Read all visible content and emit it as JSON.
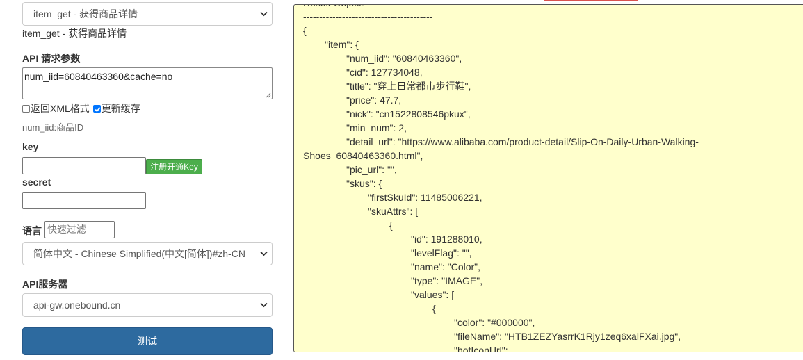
{
  "form": {
    "api_select_value": "item_get - 获得商品详情",
    "api_name_text": "item_get - 获得商品详情",
    "params_label": "API 请求参数",
    "params_value": "num_iid=60840463360&cache=no",
    "xml_checkbox_label": "返回XML格式",
    "xml_checked": false,
    "cache_checkbox_label": "更新缓存",
    "cache_checked": true,
    "param_hint": "num_iid:商品ID",
    "key_label": "key",
    "key_value": "",
    "register_button": "注册开通Key",
    "secret_label": "secret",
    "secret_value": "",
    "lang_label": "语言",
    "lang_filter_placeholder": "快速过滤",
    "lang_select_value": "简体中文 - Chinese Simplified(中文[简体])#zh-CN",
    "server_label": "API服务器",
    "server_select_value": "api-gw.onebound.cn",
    "test_button": "测试"
  },
  "result": {
    "header_partial": "Result Object:",
    "lines": [
      {
        "indent": 0,
        "text": "Result Object:"
      },
      {
        "indent": 0,
        "text": "----------------------------------------"
      },
      {
        "indent": 0,
        "text": "{"
      },
      {
        "indent": 1,
        "text": "\"item\": {"
      },
      {
        "indent": 2,
        "text": "\"num_iid\": \"60840463360\","
      },
      {
        "indent": 2,
        "text": "\"cid\": 127734048,"
      },
      {
        "indent": 2,
        "text": "\"title\": \"穿上日常都市步行鞋\","
      },
      {
        "indent": 2,
        "text": "\"price\": 47.7,"
      },
      {
        "indent": 2,
        "text": "\"nick\": \"cn1522808546pkux\","
      },
      {
        "indent": 2,
        "text": "\"min_num\": 2,"
      },
      {
        "indent": 2,
        "text": "\"detail_url\": \"https://www.alibaba.com/product-detail/Slip-On-Daily-Urban-Walking-"
      },
      {
        "indent": 0,
        "text": "Shoes_60840463360.html\","
      },
      {
        "indent": 2,
        "text": "\"pic_url\": \"\","
      },
      {
        "indent": 2,
        "text": "\"skus\": {"
      },
      {
        "indent": 3,
        "text": "\"firstSkuId\": 11485006221,"
      },
      {
        "indent": 3,
        "text": "\"skuAttrs\": ["
      },
      {
        "indent": 4,
        "text": "{"
      },
      {
        "indent": 5,
        "text": "\"id\": 191288010,"
      },
      {
        "indent": 5,
        "text": "\"levelFlag\": \"\","
      },
      {
        "indent": 5,
        "text": "\"name\": \"Color\","
      },
      {
        "indent": 5,
        "text": "\"type\": \"IMAGE\","
      },
      {
        "indent": 5,
        "text": "\"values\": ["
      },
      {
        "indent": 6,
        "text": "{"
      },
      {
        "indent": 7,
        "text": "\"color\": \"#000000\","
      },
      {
        "indent": 7,
        "text": "\"fileName\": \"HTB1ZEZYasrrK1Rjy1zeq6xalFXai.jpg\","
      },
      {
        "indent": 7,
        "text": "\"hotIconUrl\":"
      }
    ]
  },
  "colors": {
    "test_button": "#2d6a9f",
    "register_button": "#4cae4c",
    "result_background": "#ffffcc",
    "checkbox_checked": "#0075ff"
  }
}
